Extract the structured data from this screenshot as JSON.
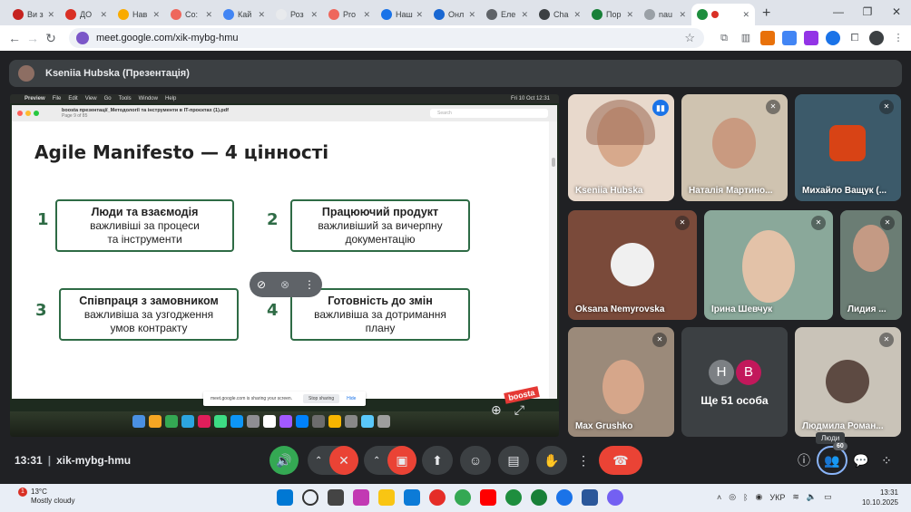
{
  "browser": {
    "tabs": [
      {
        "label": "Ви з",
        "color": "#c5221f"
      },
      {
        "label": "ДО",
        "color": "#d93025"
      },
      {
        "label": "Нав",
        "color": "#f9ab00"
      },
      {
        "label": "Co:",
        "color": "#ee675c"
      },
      {
        "label": "Кай",
        "color": "#4285f4"
      },
      {
        "label": "Роз",
        "color": "#e8eaed"
      },
      {
        "label": "Pro",
        "color": "#ee675c"
      },
      {
        "label": "Наш",
        "color": "#1a73e8"
      },
      {
        "label": "Онл",
        "color": "#1967d2"
      },
      {
        "label": "Еле",
        "color": "#5f6368"
      },
      {
        "label": "Cha",
        "color": "#3c4043"
      },
      {
        "label": "Пор",
        "color": "#188038"
      },
      {
        "label": "nau",
        "color": "#9aa0a6"
      },
      {
        "label": "",
        "color": "#1e8e3e",
        "active": true
      }
    ],
    "url": "meet.google.com/xik-mybg-hmu"
  },
  "meet": {
    "presenter_name": "Kseniia Hubska (Презентація)",
    "meeting_code": "xik-mybg-hmu",
    "time": "13:31",
    "participants_count": "60",
    "people_tooltip": "Люди",
    "more_people_label": "Ще 51 особа",
    "more_people_initials": [
      "Н",
      "В"
    ],
    "participants": [
      {
        "name": "Kseniia Hubska"
      },
      {
        "name": "Наталія Мартино..."
      },
      {
        "name": "Михайло Ващук (..."
      },
      {
        "name": "Oksana Nemyrovska"
      },
      {
        "name": "Ірина Шевчук"
      },
      {
        "name": "Лидия ..."
      },
      {
        "name": "Max Grushko"
      },
      {
        "name": "Людмила Роман..."
      }
    ]
  },
  "shared_screen": {
    "mac_menu": [
      "Preview",
      "File",
      "Edit",
      "View",
      "Go",
      "Tools",
      "Window",
      "Help"
    ],
    "mac_clock": "Fri 10 Oct 12:31",
    "file_name": "boosta презентації_Методології та інструменти в IT-проєктах (1).pdf",
    "page_info": "Page 9 of 85",
    "search_placeholder": "Search",
    "sharing_notice": "meet.google.com is sharing your screen.",
    "stop_sharing": "Stop sharing",
    "hide": "Hide",
    "brand": "boosta",
    "slide": {
      "title": "Agile Manifesto — 4 цінності",
      "values": [
        {
          "num": "1",
          "heading": "Люди та взаємодія",
          "line1": "важливіші за процеси",
          "line2": "та інструменти"
        },
        {
          "num": "2",
          "heading": "Працюючий продукт",
          "line1": "важливіший за вичерпну",
          "line2": "документацію"
        },
        {
          "num": "3",
          "heading": "Співпраця з замовником",
          "line1": "важливіша за узгодження",
          "line2": "умов контракту"
        },
        {
          "num": "4",
          "heading": "Готовність до змін",
          "line1": "важливіша за дотримання",
          "line2": "плану"
        }
      ]
    }
  },
  "taskbar": {
    "weather_temp": "13°C",
    "weather_cond": "Mostly cloudy",
    "notification_count": "1",
    "lang": "УКР",
    "time": "13:31",
    "date": "10.10.2025"
  }
}
